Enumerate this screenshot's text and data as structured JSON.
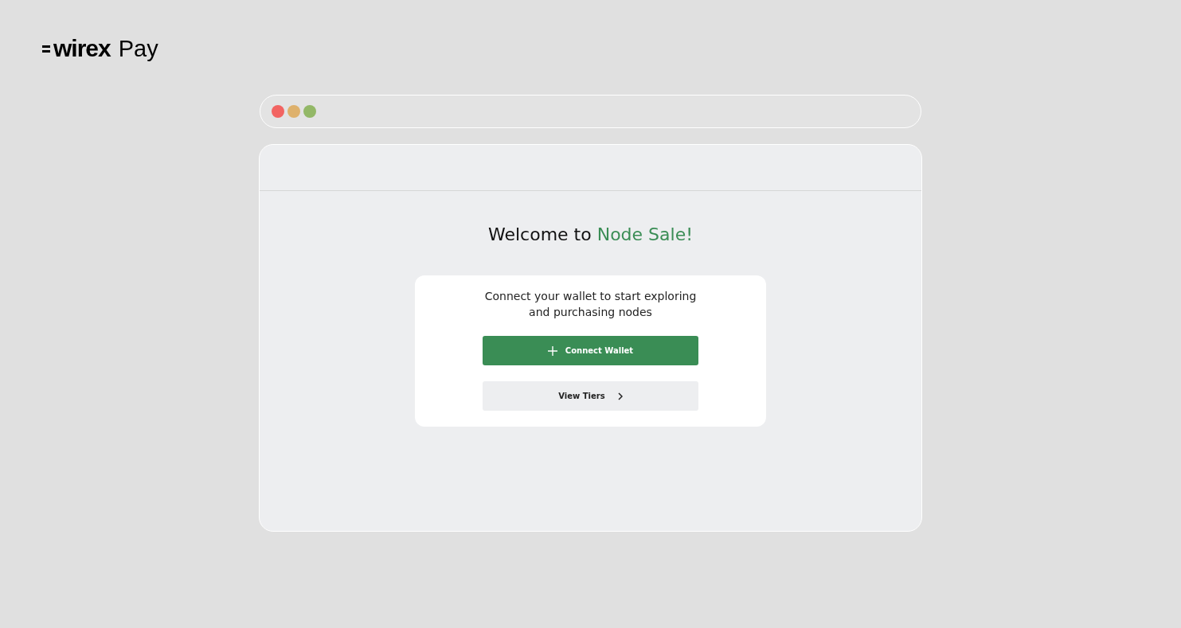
{
  "brand": {
    "name": "wirex",
    "product": "Pay"
  },
  "browser": {
    "dots": [
      {
        "color": "#f26462"
      },
      {
        "color": "#deb16c"
      },
      {
        "color": "#93b867"
      }
    ]
  },
  "welcome": {
    "lead": "Welcome to",
    "highlight": "Node Sale!"
  },
  "card": {
    "message": "Connect your wallet to start exploring and purchasing nodes",
    "buttons": [
      {
        "kind": "primary",
        "label": "Connect Wallet"
      },
      {
        "kind": "secondary",
        "label": "View Tiers"
      }
    ]
  }
}
